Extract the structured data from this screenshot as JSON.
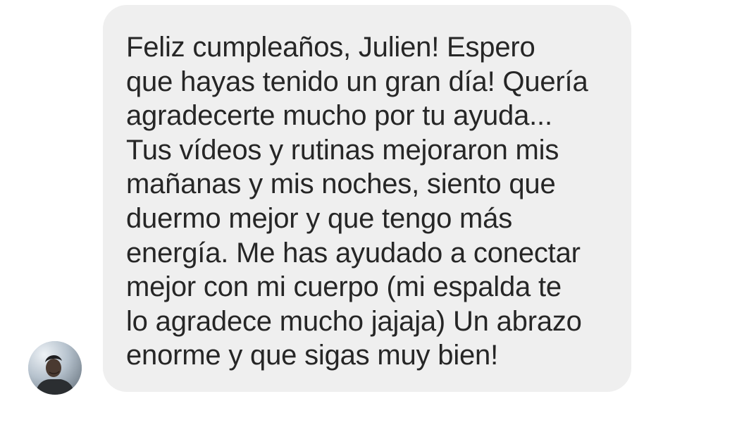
{
  "conversation": {
    "message": {
      "text": "Feliz cumpleaños, Julien! Espero\nque hayas tenido un gran día! Quería\nagradecerte mucho por tu ayuda...\nTus vídeos y rutinas mejoraron mis\nmañanas y mis noches, siento que\nduermo mejor y que tengo más\nenergía. Me has ayudado a conectar\nmejor con mi cuerpo (mi espalda te\nlo agradece mucho jajaja) Un abrazo\nenorme y que sigas muy bien!",
      "bubble_color": "#efefef",
      "text_color": "#262626"
    },
    "sender": {
      "avatar_icon": "profile-photo-icon"
    }
  }
}
